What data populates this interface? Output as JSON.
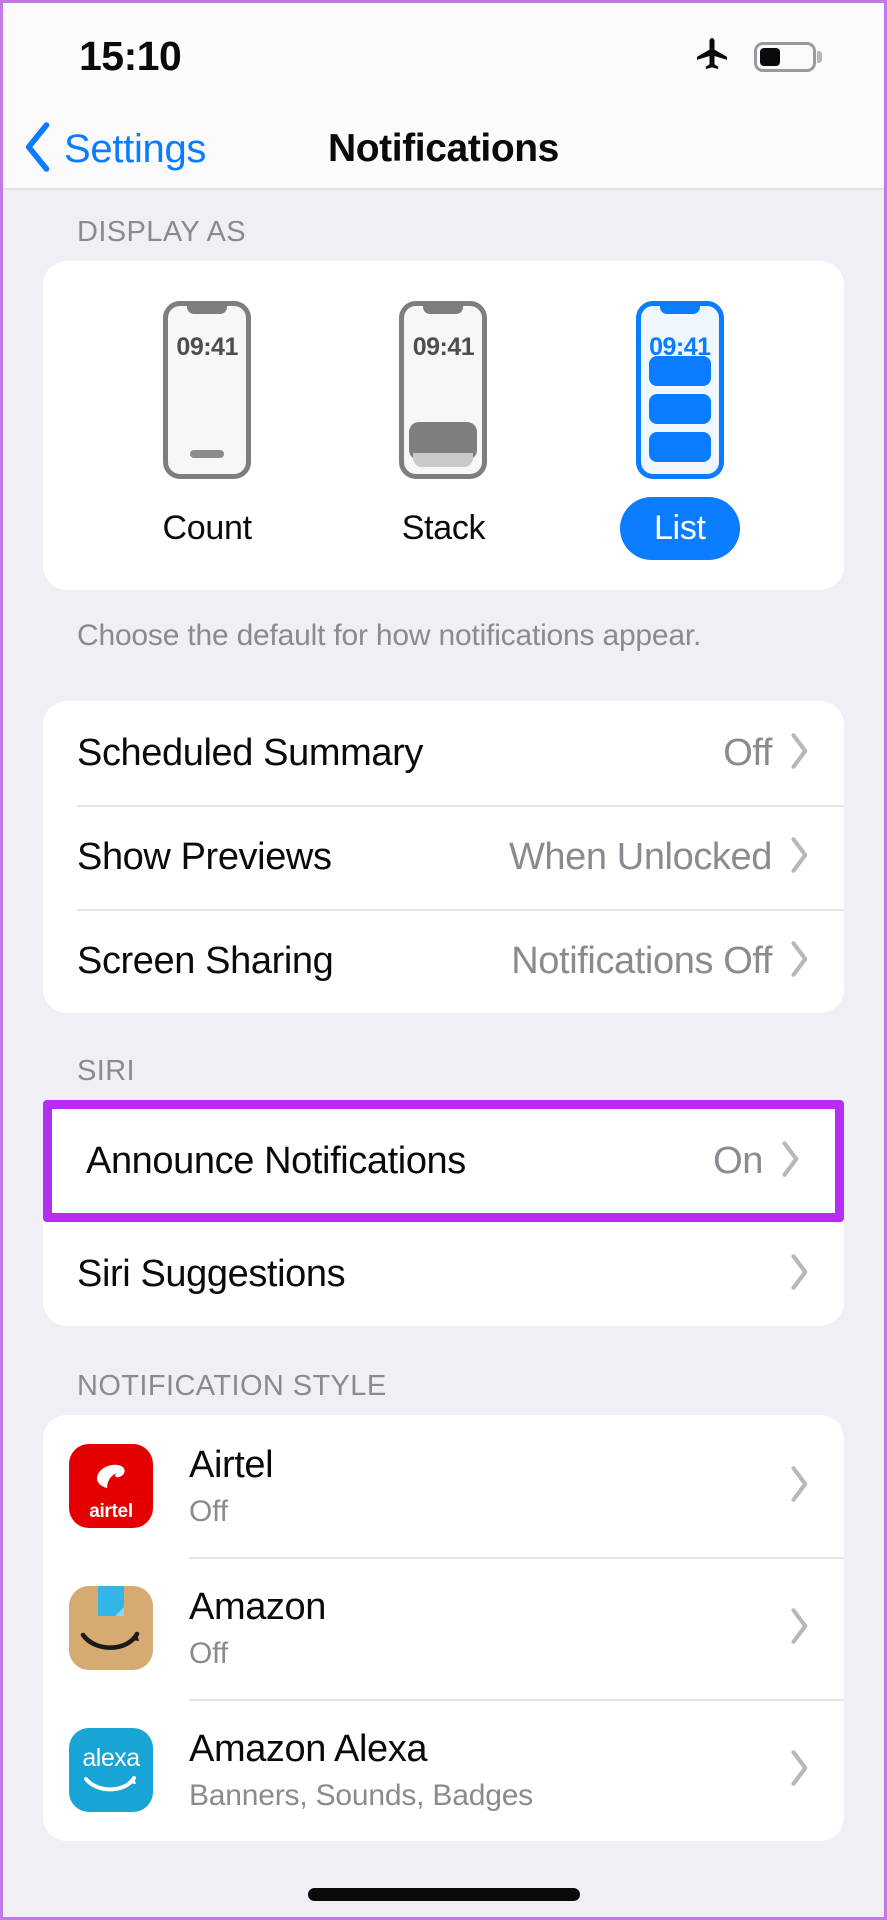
{
  "status_bar": {
    "time": "15:10",
    "airplane_icon": "airplane-mode-icon",
    "battery_icon": "battery-icon",
    "battery_level_percent": 40
  },
  "nav": {
    "back_label": "Settings",
    "back_icon": "chevron-left-icon",
    "title": "Notifications"
  },
  "display_as": {
    "header": "DISPLAY AS",
    "options": [
      {
        "label": "Count",
        "phone_time": "09:41",
        "selected": false
      },
      {
        "label": "Stack",
        "phone_time": "09:41",
        "selected": false
      },
      {
        "label": "List",
        "phone_time": "09:41",
        "selected": true
      }
    ],
    "footnote": "Choose the default for how notifications appear."
  },
  "general_rows": [
    {
      "label": "Scheduled Summary",
      "value": "Off"
    },
    {
      "label": "Show Previews",
      "value": "When Unlocked"
    },
    {
      "label": "Screen Sharing",
      "value": "Notifications Off"
    }
  ],
  "siri": {
    "header": "SIRI",
    "highlighted_row": {
      "label": "Announce Notifications",
      "value": "On"
    },
    "rows": [
      {
        "label": "Siri Suggestions",
        "value": ""
      }
    ]
  },
  "notification_style": {
    "header": "NOTIFICATION STYLE",
    "apps": [
      {
        "name": "Airtel",
        "status": "Off",
        "icon": "airtel-app-icon",
        "icon_text": "airtel"
      },
      {
        "name": "Amazon",
        "status": "Off",
        "icon": "amazon-app-icon",
        "icon_text": ""
      },
      {
        "name": "Amazon Alexa",
        "status": "Banners, Sounds, Badges",
        "icon": "alexa-app-icon",
        "icon_text": "alexa"
      }
    ]
  },
  "colors": {
    "accent_blue": "#0a7cff",
    "highlight_purple": "#b52cf5",
    "page_background": "#f1eff6",
    "card_background": "#ffffff",
    "secondary_text": "#8b8a90"
  }
}
